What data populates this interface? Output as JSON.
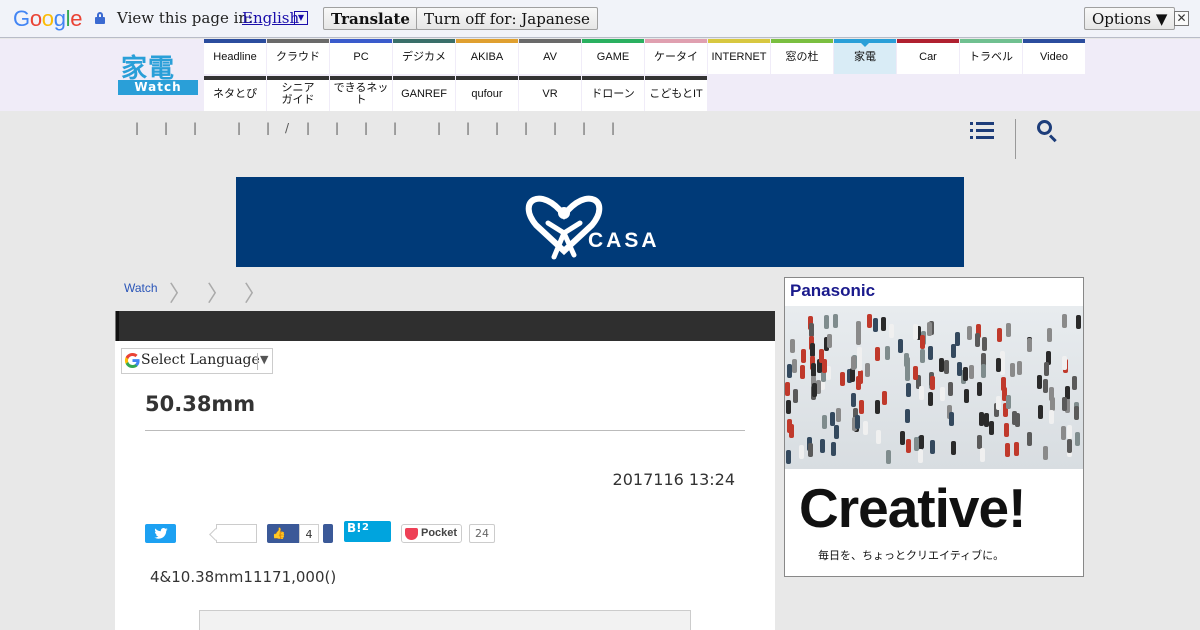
{
  "translate_bar": {
    "logo_text": "Google",
    "prompt": "View this page in:",
    "language": "English",
    "language_arrow": "▼",
    "translate_label": "Translate",
    "turn_off_label": "Turn off for: Japanese",
    "options_label": "Options ▼",
    "close_label": "✕"
  },
  "site": {
    "logo_kanji": "家電",
    "logo_sub": "Watch",
    "nav_row1": [
      {
        "label": "Headline",
        "color": "#2b4d9e"
      },
      {
        "label": "クラウド",
        "color": "#6a6a6a"
      },
      {
        "label": "PC",
        "color": "#3a5bcc"
      },
      {
        "label": "デジカメ",
        "color": "#3a6f6a"
      },
      {
        "label": "AKIBA",
        "color": "#e0a030"
      },
      {
        "label": "AV",
        "color": "#6a6a6a"
      },
      {
        "label": "GAME",
        "color": "#2ab060"
      },
      {
        "label": "ケータイ",
        "color": "#e0a0b0"
      },
      {
        "label": "INTERNET",
        "color": "#d8c840"
      },
      {
        "label": "窓の杜",
        "color": "#7abf40"
      },
      {
        "label": "家電",
        "color": "#2a9fd8",
        "active": true
      },
      {
        "label": "Car",
        "color": "#b02030"
      },
      {
        "label": "トラベル",
        "color": "#70c090"
      },
      {
        "label": "Video",
        "color": "#2b4d9e"
      }
    ],
    "nav_row2": [
      {
        "label": "ネタとぴ"
      },
      {
        "label": "シニア\nガイド"
      },
      {
        "label": "できるネット"
      },
      {
        "label": "GANREF"
      },
      {
        "label": "qufour"
      },
      {
        "label": "VR"
      },
      {
        "label": "ドローン"
      },
      {
        "label": "こどもとIT"
      }
    ],
    "subnav_separators": [
      "|",
      "|",
      "|",
      "|",
      "|",
      "/",
      "|",
      "|",
      "|",
      "|",
      "|",
      "|",
      "|",
      "|",
      "|",
      "|",
      "|"
    ]
  },
  "banner": {
    "text": "CASA",
    "color": "#003a78"
  },
  "breadcrumb": {
    "items": [
      "Watch"
    ],
    "chevron": "〉"
  },
  "article": {
    "language_select": "Select Language",
    "language_arrow": "▼",
    "title": "50.38mm",
    "date": "2017116 13:24",
    "share": {
      "facebook_count": "4",
      "hatena_label": "B!",
      "hatena_count": "2",
      "pocket_label": "Pocket",
      "pocket_count": "24"
    },
    "body": "4&10.38mm11171,000()"
  },
  "side_ad": {
    "brand": "Panasonic",
    "headline": "Creative!",
    "tagline": "毎日を、ちょっとクリエイティブに。"
  }
}
